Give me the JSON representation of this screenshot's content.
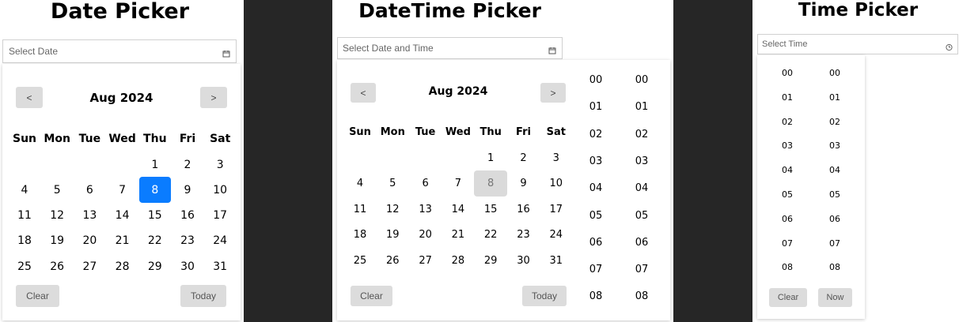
{
  "date_picker": {
    "title": "Date Picker",
    "placeholder": "Select Date",
    "prev_label": "<",
    "next_label": ">",
    "month_label": "Aug 2024",
    "weekdays": [
      "Sun",
      "Mon",
      "Tue",
      "Wed",
      "Thu",
      "Fri",
      "Sat"
    ],
    "weeks": [
      [
        "",
        "",
        "",
        "",
        "1",
        "2",
        "3"
      ],
      [
        "4",
        "5",
        "6",
        "7",
        "8",
        "9",
        "10"
      ],
      [
        "11",
        "12",
        "13",
        "14",
        "15",
        "16",
        "17"
      ],
      [
        "18",
        "19",
        "20",
        "21",
        "22",
        "23",
        "24"
      ],
      [
        "25",
        "26",
        "27",
        "28",
        "29",
        "30",
        "31"
      ]
    ],
    "selected_day": "8",
    "clear_label": "Clear",
    "today_label": "Today",
    "accent_color": "#0a7cff"
  },
  "datetime_picker": {
    "title": "DateTime Picker",
    "placeholder": "Select Date and Time",
    "prev_label": "<",
    "next_label": ">",
    "month_label": "Aug 2024",
    "weekdays": [
      "Sun",
      "Mon",
      "Tue",
      "Wed",
      "Thu",
      "Fri",
      "Sat"
    ],
    "weeks": [
      [
        "",
        "",
        "",
        "",
        "1",
        "2",
        "3"
      ],
      [
        "4",
        "5",
        "6",
        "7",
        "8",
        "9",
        "10"
      ],
      [
        "11",
        "12",
        "13",
        "14",
        "15",
        "16",
        "17"
      ],
      [
        "18",
        "19",
        "20",
        "21",
        "22",
        "23",
        "24"
      ],
      [
        "25",
        "26",
        "27",
        "28",
        "29",
        "30",
        "31"
      ]
    ],
    "selected_day": "8",
    "hours_col1": [
      "00",
      "01",
      "02",
      "03",
      "04",
      "05",
      "06",
      "07",
      "08"
    ],
    "hours_col2": [
      "00",
      "01",
      "02",
      "03",
      "04",
      "05",
      "06",
      "07",
      "08"
    ],
    "clear_label": "Clear",
    "today_label": "Today"
  },
  "time_picker": {
    "title": "Time Picker",
    "placeholder": "Select Time",
    "hours_col1": [
      "00",
      "01",
      "02",
      "03",
      "04",
      "05",
      "06",
      "07",
      "08"
    ],
    "hours_col2": [
      "00",
      "01",
      "02",
      "03",
      "04",
      "05",
      "06",
      "07",
      "08"
    ],
    "clear_label": "Clear",
    "now_label": "Now"
  },
  "icons": {
    "calendar": "calendar-icon",
    "clock": "clock-icon"
  }
}
